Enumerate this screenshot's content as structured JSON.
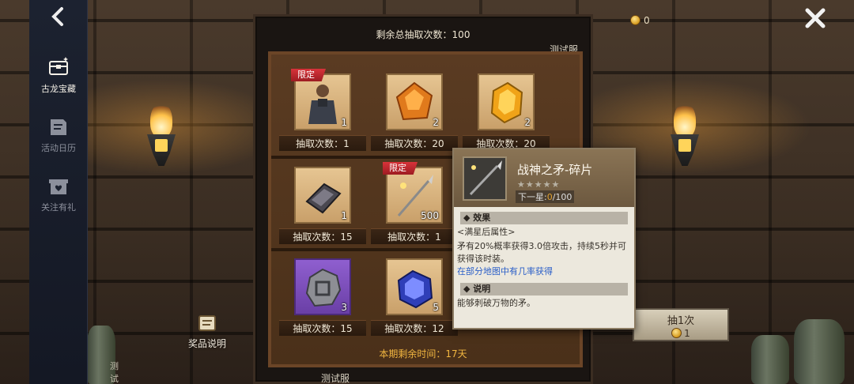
{
  "sidebar": {
    "items": [
      {
        "label": "古龙宝藏",
        "icon": "treasure-chest-icon",
        "active": true
      },
      {
        "label": "活动日历",
        "icon": "calendar-book-icon",
        "active": false
      },
      {
        "label": "关注有礼",
        "icon": "gift-heart-icon",
        "active": false
      }
    ],
    "footer_tag": "测试服"
  },
  "header": {
    "coins": "0"
  },
  "panel": {
    "remain_total": "剩余总抽取次数：100",
    "test_tag_top": "测试服",
    "test_tag_bottom": "测试服",
    "period_remaining": "本期剩余时间：17天",
    "items": [
      {
        "qty": "1",
        "draws": "抽取次数：1",
        "limited": "限定",
        "icon": "warrior-character-icon"
      },
      {
        "qty": "2",
        "draws": "抽取次数：20",
        "icon": "orange-gem-icon"
      },
      {
        "qty": "2",
        "draws": "抽取次数：20",
        "icon": "amber-crystal-icon"
      },
      {
        "qty": "1",
        "draws": "抽取次数：15",
        "icon": "iron-ingot-icon"
      },
      {
        "qty": "500",
        "draws": "抽取次数：1",
        "limited": "限定",
        "icon": "spear-icon"
      },
      {
        "qty": "3",
        "draws": "抽取次数：15",
        "icon": "silver-token-icon"
      },
      {
        "qty": "5",
        "draws": "抽取次数：12",
        "icon": "blue-gem-icon"
      }
    ]
  },
  "prize_info": {
    "label": "奖品说明"
  },
  "draw_button": {
    "label": "抽1次",
    "cost": "1"
  },
  "tooltip": {
    "name": "战神之矛-碎片",
    "stars": "★★★★★",
    "next_star_prefix": "下一星:",
    "next_star_current": "0",
    "next_star_total": "/100",
    "section_effect": "效果",
    "effect_line1": "<满星后属性>",
    "effect_line2": "矛有20%概率获得3.0倍攻击，持续5秒并可获得该时装。",
    "effect_link": "在部分地图中有几率获得",
    "section_desc": "说明",
    "desc_text": "能够刺破万物的矛。"
  }
}
